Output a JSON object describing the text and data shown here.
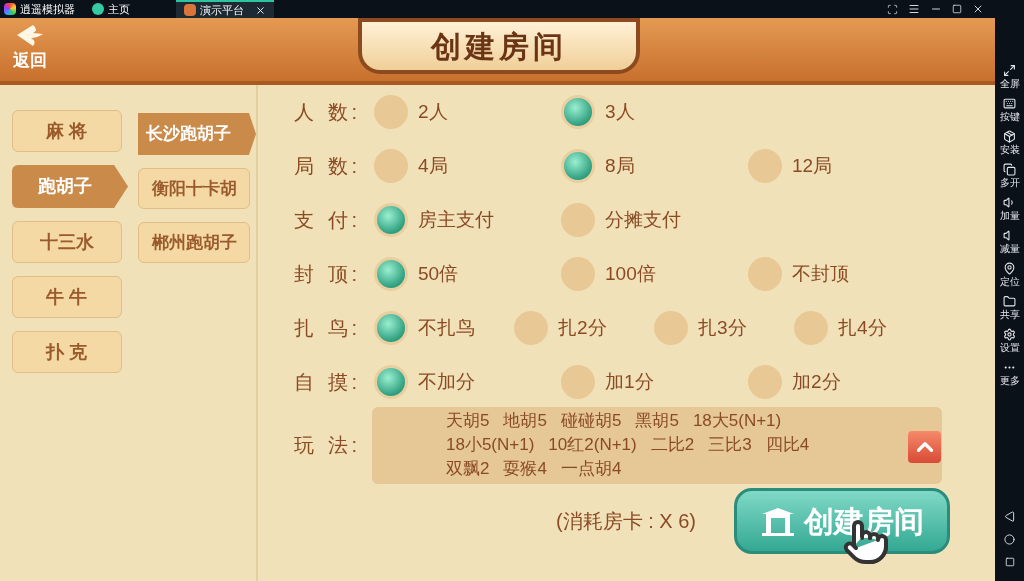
{
  "emulator": {
    "tabs": [
      {
        "label": "逍遥模拟器",
        "kind": "app"
      },
      {
        "label": "主页",
        "kind": "tab",
        "selected": false
      },
      {
        "label": "演示平台",
        "kind": "tab",
        "selected": true
      }
    ],
    "tools": [
      {
        "label": "全屏",
        "kind": "fullscreen"
      },
      {
        "label": "按键",
        "kind": "keyboard"
      },
      {
        "label": "安装",
        "kind": "apk"
      },
      {
        "label": "多开",
        "kind": "multi"
      },
      {
        "label": "加量",
        "kind": "volup"
      },
      {
        "label": "减量",
        "kind": "voldown"
      },
      {
        "label": "定位",
        "kind": "location"
      },
      {
        "label": "共享",
        "kind": "folder"
      },
      {
        "label": "设置",
        "kind": "settings"
      },
      {
        "label": "更多",
        "kind": "more"
      }
    ]
  },
  "header": {
    "back_label": "返回",
    "title": "创建房间"
  },
  "categories": [
    {
      "label": "麻 将",
      "selected": false
    },
    {
      "label": "跑胡子",
      "selected": true
    },
    {
      "label": "十三水",
      "selected": false
    },
    {
      "label": "牛 牛",
      "selected": false
    },
    {
      "label": "扑 克",
      "selected": false
    }
  ],
  "variants": [
    {
      "label": "长沙跑胡子",
      "selected": true
    },
    {
      "label": "衡阳十卡胡",
      "selected": false
    },
    {
      "label": "郴州跑胡子",
      "selected": false
    }
  ],
  "options": [
    {
      "label": "人 数:",
      "choices": [
        {
          "label": "2人",
          "selected": false
        },
        {
          "label": "3人",
          "selected": true
        }
      ]
    },
    {
      "label": "局 数:",
      "choices": [
        {
          "label": "4局",
          "selected": false
        },
        {
          "label": "8局",
          "selected": true
        },
        {
          "label": "12局",
          "selected": false
        }
      ]
    },
    {
      "label": "支 付:",
      "choices": [
        {
          "label": "房主支付",
          "selected": true
        },
        {
          "label": "分摊支付",
          "selected": false
        }
      ]
    },
    {
      "label": "封 顶:",
      "choices": [
        {
          "label": "50倍",
          "selected": true
        },
        {
          "label": "100倍",
          "selected": false
        },
        {
          "label": "不封顶",
          "selected": false
        }
      ]
    },
    {
      "label": "扎 鸟:",
      "choices": [
        {
          "label": "不扎鸟",
          "selected": true
        },
        {
          "label": "扎2分",
          "selected": false
        },
        {
          "label": "扎3分",
          "selected": false
        },
        {
          "label": "扎4分",
          "selected": false
        }
      ]
    },
    {
      "label": "自 摸:",
      "choices": [
        {
          "label": "不加分",
          "selected": true
        },
        {
          "label": "加1分",
          "selected": false
        },
        {
          "label": "加2分",
          "selected": false
        }
      ]
    }
  ],
  "play": {
    "label": "玩 法:",
    "lines": [
      [
        "天胡5",
        "地胡5",
        "碰碰胡5",
        "黑胡5",
        "18大5(N+1)"
      ],
      [
        "18小5(N+1)",
        "10红2(N+1)",
        "二比2",
        "三比3",
        "四比4"
      ],
      [
        "双飘2",
        "耍猴4",
        "一点胡4"
      ]
    ]
  },
  "cost": "(消耗房卡 : X 6)",
  "create_button": "创建房间"
}
